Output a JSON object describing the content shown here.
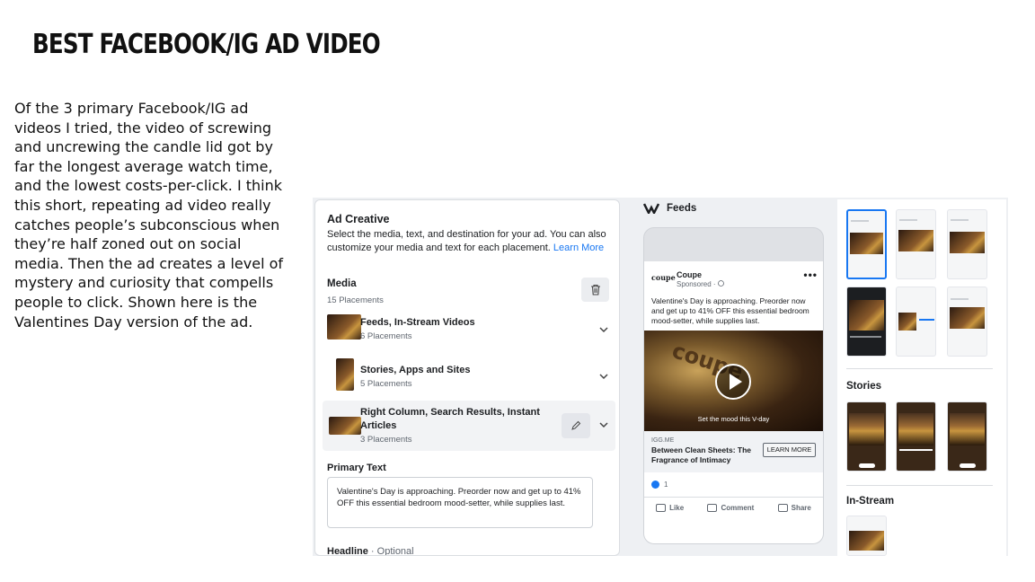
{
  "slide": {
    "title": "BEST FACEBOOK/IG AD VIDEO",
    "body": "Of the 3 primary Facebook/IG ad videos I tried, the video of screwing and uncrewing the candle lid got by far the longest average watch time, and the lowest costs-per-click. I think this short, repeating ad video really catches people’s subconscious when they’re half zoned out on social media. Then the ad creates a level of mystery and curiosity that compells people to click. Shown here is the Valentines Day version of the ad."
  },
  "editor": {
    "title": "Ad Creative",
    "subtitle": "Select the media, text, and destination for your ad. You can also customize your media and text for each placement.",
    "learn_more": "Learn More",
    "media_heading": "Media",
    "media_count": "15 Placements",
    "placements": [
      {
        "name": "Feeds, In-Stream Videos",
        "count": "6 Placements"
      },
      {
        "name": "Stories, Apps and Sites",
        "count": "5 Placements"
      },
      {
        "name": "Right Column, Search Results, Instant Articles",
        "count": "3 Placements"
      }
    ],
    "primary_text_label": "Primary Text",
    "primary_text_value": "Valentine's Day is approaching. Preorder now and get up to 41% OFF this essential bedroom mood-setter, while supplies last.",
    "headline_label": "Headline",
    "headline_optional": "· Optional"
  },
  "preview": {
    "section": "Feeds",
    "logo_text": "coupe",
    "page_name": "Coupe",
    "sponsored": "Sponsored · ",
    "post_text": "Valentine's Day is approaching. Preorder now and get up to 41% OFF this essential bedroom mood-setter, while supplies last.",
    "video_word": "coupe",
    "video_caption": "Set the mood this V-day",
    "link_domain": "IGG.ME",
    "link_title": "Between Clean Sheets: The Fragrance of Intimacy",
    "cta": "LEARN MORE",
    "reactions": "1",
    "actions": [
      "Like",
      "Comment",
      "Share"
    ]
  },
  "thumbs": {
    "stories_heading": "Stories",
    "instream_heading": "In-Stream"
  },
  "colors": {
    "accent": "#1877f2",
    "text": "#1c1e21",
    "muted": "#606770"
  }
}
